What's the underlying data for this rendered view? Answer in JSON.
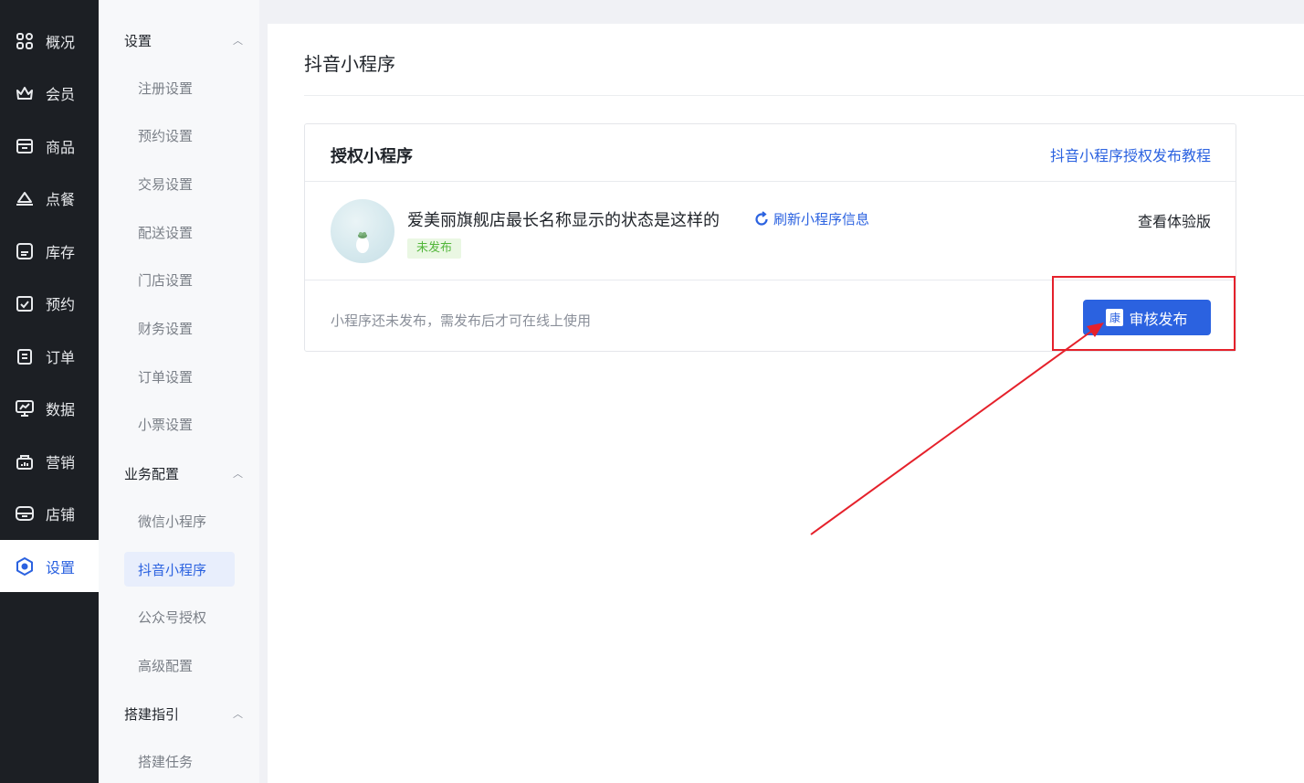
{
  "nav_primary": {
    "items": [
      {
        "label": "概况",
        "icon": "dashboard-grid-icon"
      },
      {
        "label": "会员",
        "icon": "crown-icon"
      },
      {
        "label": "商品",
        "icon": "store-icon"
      },
      {
        "label": "点餐",
        "icon": "dish-cover-icon"
      },
      {
        "label": "库存",
        "icon": "inventory-icon"
      },
      {
        "label": "预约",
        "icon": "calendar-check-icon"
      },
      {
        "label": "订单",
        "icon": "clipboard-icon"
      },
      {
        "label": "数据",
        "icon": "chart-monitor-icon"
      },
      {
        "label": "营销",
        "icon": "gift-icon"
      },
      {
        "label": "店铺",
        "icon": "shop-icon"
      },
      {
        "label": "设置",
        "icon": "settings-icon",
        "active": true
      }
    ]
  },
  "nav_secondary": {
    "groups": [
      {
        "label": "设置",
        "items": [
          "注册设置",
          "预约设置",
          "交易设置",
          "配送设置",
          "门店设置",
          "财务设置",
          "订单设置",
          "小票设置"
        ]
      },
      {
        "label": "业务配置",
        "items": [
          "微信小程序",
          "抖音小程序",
          "公众号授权",
          "高级配置"
        ]
      },
      {
        "label": "搭建指引",
        "items": [
          "搭建任务"
        ]
      }
    ],
    "active_item": "抖音小程序"
  },
  "main": {
    "title": "抖音小程序",
    "card": {
      "title": "授权小程序",
      "tutorial_link": "抖音小程序授权发布教程",
      "app_name": "爱美丽旗舰店最长名称显示的状态是这样的",
      "refresh_label": "刷新小程序信息",
      "status": "未发布",
      "preview_label": "查看体验版",
      "note": "小程序还未发布，需发布后才可在线上使用",
      "publish_icon_char": "康",
      "publish_label": "审核发布"
    }
  },
  "colors": {
    "accent": "#2b62e0",
    "sidebar_dark": "#1c1f24",
    "annotation_red": "#e5212b",
    "status_green": "#52b63a"
  }
}
